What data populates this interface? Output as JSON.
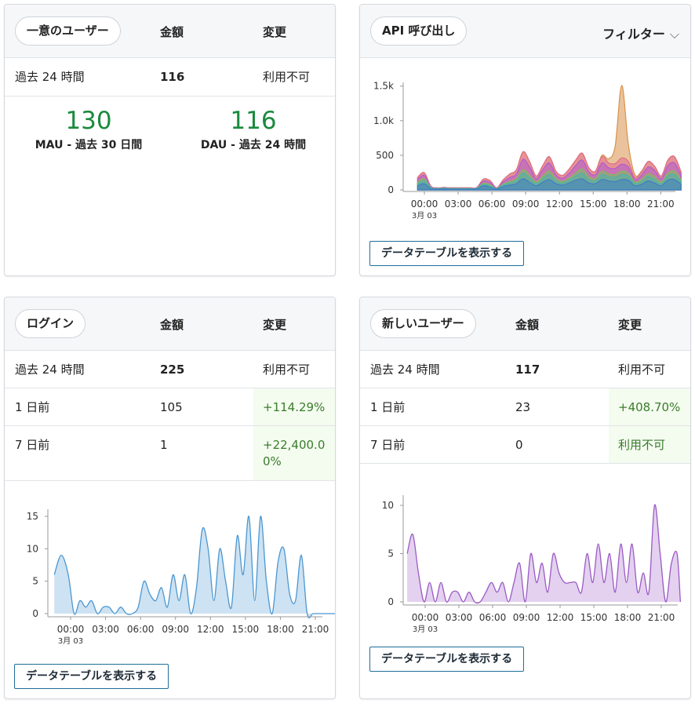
{
  "colors": {
    "green_text": "#1a8a3e",
    "positive_change": "#3a7d2c",
    "positive_bg": "#f4fbef",
    "button_border": "#1f6f9a",
    "login_series": "#4b97d0",
    "new_users_series": "#9b59c4"
  },
  "unique_users": {
    "title": "一意のユーザー",
    "col_amount": "金額",
    "col_change": "変更",
    "rows": [
      {
        "period": "過去 24 時間",
        "amount": "116",
        "change": "利用不可"
      }
    ],
    "mau_value": "130",
    "mau_label": "MAU - 過去 30 日間",
    "dau_value": "116",
    "dau_label": "DAU - 過去 24 時間"
  },
  "api_calls": {
    "title": "API 呼び出し",
    "filter_label": "フィルター",
    "filter_icon": "chevron-down-icon",
    "button_label": "データテーブルを表示する"
  },
  "logins": {
    "title": "ログイン",
    "col_amount": "金額",
    "col_change": "変更",
    "rows": [
      {
        "period": "過去 24 時間",
        "amount": "225",
        "change": "利用不可"
      },
      {
        "period": "1 日前",
        "amount": "105",
        "change": "+114.29%"
      },
      {
        "period": "7 日前",
        "amount": "1",
        "change": "+22,400.0\n0%"
      }
    ],
    "button_label": "データテーブルを表示する"
  },
  "new_users": {
    "title": "新しいユーザー",
    "col_amount": "金額",
    "col_change": "変更",
    "rows": [
      {
        "period": "過去 24 時間",
        "amount": "117",
        "change": "利用不可"
      },
      {
        "period": "1 日前",
        "amount": "23",
        "change": "+408.70%"
      },
      {
        "period": "7 日前",
        "amount": "0",
        "change": "利用不可"
      }
    ],
    "button_label": "データテーブルを表示する"
  },
  "chart_data": [
    {
      "id": "api",
      "type": "area",
      "stacked": true,
      "x_ticks": [
        "00:00",
        "03:00",
        "06:00",
        "09:00",
        "12:00",
        "15:00",
        "18:00",
        "21:00"
      ],
      "x_sub_label": "3月 03",
      "y_ticks": [
        "0",
        "500",
        "1.0k",
        "1.5k"
      ],
      "ylim": [
        0,
        1600
      ],
      "x_hours": [
        -1,
        -0.5,
        0,
        1,
        2,
        3,
        4,
        5,
        6,
        6.5,
        7,
        7.5,
        8,
        8.5,
        9,
        9.5,
        10,
        10.5,
        11,
        11.5,
        12,
        12.5,
        13,
        13.5,
        14,
        14.5,
        15,
        15.5,
        16,
        16.5,
        17,
        17.5,
        18,
        18.5,
        19,
        19.5,
        20,
        20.5,
        21,
        21.5,
        22,
        22.5,
        23
      ],
      "series": [
        {
          "color": "#3f7fc4",
          "values": [
            60,
            90,
            20,
            10,
            15,
            10,
            10,
            10,
            10,
            15,
            60,
            40,
            10,
            50,
            70,
            90,
            160,
            110,
            60,
            110,
            150,
            90,
            70,
            100,
            140,
            160,
            100,
            90,
            150,
            130,
            120,
            150,
            140,
            60,
            80,
            130,
            100,
            60,
            140,
            150,
            80
          ]
        },
        {
          "color": "#49b7a8",
          "values": [
            30,
            40,
            10,
            5,
            5,
            5,
            5,
            5,
            5,
            5,
            20,
            20,
            5,
            20,
            30,
            40,
            80,
            60,
            30,
            50,
            70,
            40,
            30,
            40,
            60,
            80,
            50,
            40,
            70,
            60,
            60,
            70,
            60,
            30,
            40,
            60,
            50,
            30,
            60,
            70,
            40
          ]
        },
        {
          "color": "#7dbf5b",
          "values": [
            20,
            30,
            5,
            5,
            5,
            5,
            5,
            5,
            5,
            5,
            15,
            15,
            5,
            15,
            20,
            30,
            50,
            40,
            20,
            40,
            50,
            30,
            20,
            30,
            40,
            60,
            40,
            30,
            50,
            40,
            40,
            50,
            40,
            20,
            30,
            40,
            40,
            20,
            40,
            50,
            30
          ]
        },
        {
          "color": "#b05bd0",
          "values": [
            40,
            50,
            10,
            5,
            5,
            5,
            5,
            5,
            5,
            5,
            30,
            30,
            5,
            30,
            60,
            70,
            150,
            120,
            50,
            90,
            120,
            60,
            50,
            70,
            110,
            130,
            70,
            60,
            120,
            90,
            90,
            100,
            90,
            40,
            60,
            100,
            90,
            50,
            110,
            120,
            60
          ]
        },
        {
          "color": "#e06b8a",
          "values": [
            30,
            40,
            10,
            5,
            5,
            5,
            5,
            5,
            5,
            5,
            30,
            30,
            5,
            30,
            50,
            60,
            110,
            80,
            40,
            60,
            90,
            50,
            40,
            60,
            80,
            100,
            60,
            50,
            90,
            70,
            70,
            90,
            80,
            30,
            50,
            80,
            60,
            40,
            80,
            90,
            50
          ]
        },
        {
          "color": "#d8914a",
          "values": [
            0,
            0,
            0,
            0,
            0,
            0,
            0,
            0,
            0,
            0,
            0,
            0,
            0,
            0,
            0,
            0,
            0,
            0,
            0,
            0,
            0,
            0,
            0,
            0,
            0,
            0,
            0,
            0,
            20,
            60,
            250,
            1050,
            250,
            40,
            10,
            0,
            0,
            0,
            0,
            0,
            0
          ]
        }
      ]
    },
    {
      "id": "logins",
      "type": "area",
      "x_ticks": [
        "00:00",
        "03:00",
        "06:00",
        "09:00",
        "12:00",
        "15:00",
        "18:00",
        "21:00"
      ],
      "x_sub_label": "3月 03",
      "y_ticks": [
        "0",
        "5",
        "10",
        "15"
      ],
      "ylim": [
        0,
        16
      ],
      "series": [
        {
          "name": "",
          "x": [
            -1.4,
            -0.8,
            -0.2,
            0.3,
            0.8,
            1.3,
            1.8,
            2.3,
            2.8,
            3.3,
            3.8,
            4.3,
            4.8,
            5.3,
            5.8,
            6.3,
            6.8,
            7.3,
            7.8,
            8.3,
            8.8,
            9.3,
            9.8,
            10.3,
            10.8,
            11.3,
            11.8,
            12.3,
            12.8,
            13.3,
            13.8,
            14.3,
            14.8,
            15.3,
            15.8,
            16.3,
            16.8,
            17.3,
            17.8,
            18.3,
            18.8,
            19.3,
            19.8,
            20.3,
            20.8,
            21.3,
            21.8,
            22.3,
            22.8,
            23.2
          ],
          "values": [
            6,
            9,
            6,
            0,
            2,
            1,
            2,
            0,
            1,
            1,
            0,
            1,
            0,
            0,
            1,
            5,
            3,
            2,
            4,
            1,
            6,
            2,
            6,
            0,
            4,
            13,
            10,
            2,
            10,
            5,
            1,
            12,
            6,
            15,
            2,
            15,
            5,
            0,
            8,
            10,
            3,
            2,
            9,
            0,
            0,
            0,
            0,
            0,
            0,
            0
          ]
        }
      ]
    },
    {
      "id": "new_users",
      "type": "area",
      "x_ticks": [
        "00:00",
        "03:00",
        "06:00",
        "09:00",
        "12:00",
        "15:00",
        "18:00",
        "21:00"
      ],
      "x_sub_label": "3月 03",
      "y_ticks": [
        "0",
        "5",
        "10"
      ],
      "ylim": [
        0,
        10.5
      ],
      "series": [
        {
          "name": "",
          "x": [
            -1.6,
            -1.1,
            -0.6,
            -0.1,
            0.4,
            0.9,
            1.4,
            1.9,
            2.4,
            2.9,
            3.4,
            3.9,
            4.4,
            4.9,
            5.4,
            5.9,
            6.4,
            6.9,
            7.4,
            7.9,
            8.4,
            8.9,
            9.4,
            9.9,
            10.4,
            10.9,
            11.4,
            11.9,
            12.4,
            12.9,
            13.4,
            13.9,
            14.4,
            14.9,
            15.4,
            15.9,
            16.4,
            16.9,
            17.4,
            17.9,
            18.4,
            18.9,
            19.4,
            19.9,
            20.4,
            20.9,
            21.4,
            21.9,
            22.4,
            22.7
          ],
          "values": [
            5,
            7,
            3,
            0,
            2,
            0,
            2,
            0,
            1,
            1,
            0,
            1,
            0,
            0,
            1,
            2,
            1,
            2,
            0,
            2,
            4,
            0,
            5,
            2,
            4,
            1,
            5,
            3,
            2,
            2,
            2,
            1,
            5,
            2,
            6,
            2,
            5,
            1,
            6,
            2,
            6,
            1,
            3,
            1,
            10,
            5,
            0,
            4,
            5,
            0
          ]
        }
      ]
    }
  ]
}
